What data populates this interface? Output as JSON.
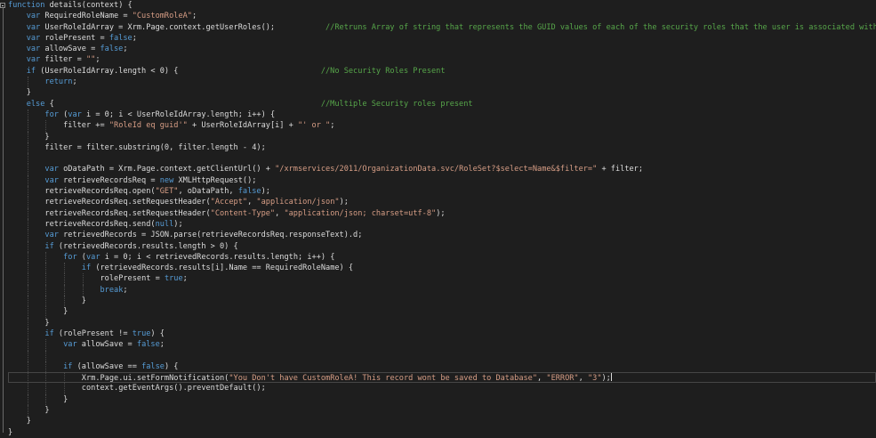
{
  "editor": {
    "background": "#1e1e1e",
    "colors": {
      "keyword": "#569cd6",
      "string": "#d69d85",
      "comment": "#57a64a",
      "text": "#dcdcdc"
    },
    "current_line": 34,
    "lines": [
      {
        "indent": 0,
        "tokens": [
          {
            "t": "kw",
            "v": "function"
          },
          {
            "t": "txt",
            "v": " details(context) {"
          }
        ]
      },
      {
        "indent": 1,
        "tokens": [
          {
            "t": "kw",
            "v": "var"
          },
          {
            "t": "txt",
            "v": " RequiredRoleName = "
          },
          {
            "t": "str",
            "v": "\"CustomRoleA\""
          },
          {
            "t": "txt",
            "v": ";"
          }
        ]
      },
      {
        "indent": 1,
        "tokens": [
          {
            "t": "kw",
            "v": "var"
          },
          {
            "t": "txt",
            "v": " UserRoleIdArray = Xrm.Page.context.getUserRoles();           "
          },
          {
            "t": "com",
            "v": "//Retruns Array of string that represents the GUID values of each of the security roles that the user is associated with"
          }
        ]
      },
      {
        "indent": 1,
        "tokens": [
          {
            "t": "kw",
            "v": "var"
          },
          {
            "t": "txt",
            "v": " rolePresent = "
          },
          {
            "t": "kw",
            "v": "false"
          },
          {
            "t": "txt",
            "v": ";"
          }
        ]
      },
      {
        "indent": 1,
        "tokens": [
          {
            "t": "kw",
            "v": "var"
          },
          {
            "t": "txt",
            "v": " allowSave = "
          },
          {
            "t": "kw",
            "v": "false"
          },
          {
            "t": "txt",
            "v": ";"
          }
        ]
      },
      {
        "indent": 1,
        "tokens": [
          {
            "t": "kw",
            "v": "var"
          },
          {
            "t": "txt",
            "v": " filter = "
          },
          {
            "t": "str",
            "v": "\"\""
          },
          {
            "t": "txt",
            "v": ";"
          }
        ]
      },
      {
        "indent": 1,
        "tokens": [
          {
            "t": "kw",
            "v": "if"
          },
          {
            "t": "txt",
            "v": " (UserRoleIdArray.length < 0) {                               "
          },
          {
            "t": "com",
            "v": "//No Security Roles Present"
          }
        ]
      },
      {
        "indent": 2,
        "tokens": [
          {
            "t": "kw",
            "v": "return"
          },
          {
            "t": "txt",
            "v": ";"
          }
        ]
      },
      {
        "indent": 1,
        "tokens": [
          {
            "t": "txt",
            "v": "}"
          }
        ]
      },
      {
        "indent": 1,
        "tokens": [
          {
            "t": "kw",
            "v": "else"
          },
          {
            "t": "txt",
            "v": " {                                                          "
          },
          {
            "t": "com",
            "v": "//Multiple Security roles present"
          }
        ]
      },
      {
        "indent": 2,
        "tokens": [
          {
            "t": "kw",
            "v": "for"
          },
          {
            "t": "txt",
            "v": " ("
          },
          {
            "t": "kw",
            "v": "var"
          },
          {
            "t": "txt",
            "v": " i = 0; i < UserRoleIdArray.length; i++) {"
          }
        ]
      },
      {
        "indent": 3,
        "tokens": [
          {
            "t": "txt",
            "v": "filter += "
          },
          {
            "t": "str",
            "v": "\"RoleId eq guid'\""
          },
          {
            "t": "txt",
            "v": " + UserRoleIdArray[i] + "
          },
          {
            "t": "str",
            "v": "\"' or \""
          },
          {
            "t": "txt",
            "v": ";"
          }
        ]
      },
      {
        "indent": 2,
        "tokens": [
          {
            "t": "txt",
            "v": "}"
          }
        ]
      },
      {
        "indent": 2,
        "tokens": [
          {
            "t": "txt",
            "v": "filter = filter.substring(0, filter.length - 4);"
          }
        ]
      },
      {
        "indent": 2,
        "tokens": []
      },
      {
        "indent": 2,
        "tokens": [
          {
            "t": "kw",
            "v": "var"
          },
          {
            "t": "txt",
            "v": " oDataPath = Xrm.Page.context.getClientUrl() + "
          },
          {
            "t": "str",
            "v": "\"/xrmservices/2011/OrganizationData.svc/RoleSet?$select=Name&$filter=\""
          },
          {
            "t": "txt",
            "v": " + filter;"
          }
        ]
      },
      {
        "indent": 2,
        "tokens": [
          {
            "t": "kw",
            "v": "var"
          },
          {
            "t": "txt",
            "v": " retrieveRecordsReq = "
          },
          {
            "t": "kw",
            "v": "new"
          },
          {
            "t": "txt",
            "v": " XMLHttpRequest();"
          }
        ]
      },
      {
        "indent": 2,
        "tokens": [
          {
            "t": "txt",
            "v": "retrieveRecordsReq.open("
          },
          {
            "t": "str",
            "v": "\"GET\""
          },
          {
            "t": "txt",
            "v": ", oDataPath, "
          },
          {
            "t": "kw",
            "v": "false"
          },
          {
            "t": "txt",
            "v": ");"
          }
        ]
      },
      {
        "indent": 2,
        "tokens": [
          {
            "t": "txt",
            "v": "retrieveRecordsReq.setRequestHeader("
          },
          {
            "t": "str",
            "v": "\"Accept\""
          },
          {
            "t": "txt",
            "v": ", "
          },
          {
            "t": "str",
            "v": "\"application/json\""
          },
          {
            "t": "txt",
            "v": ");"
          }
        ]
      },
      {
        "indent": 2,
        "tokens": [
          {
            "t": "txt",
            "v": "retrieveRecordsReq.setRequestHeader("
          },
          {
            "t": "str",
            "v": "\"Content-Type\""
          },
          {
            "t": "txt",
            "v": ", "
          },
          {
            "t": "str",
            "v": "\"application/json; charset=utf-8\""
          },
          {
            "t": "txt",
            "v": ");"
          }
        ]
      },
      {
        "indent": 2,
        "tokens": [
          {
            "t": "txt",
            "v": "retrieveRecordsReq.send("
          },
          {
            "t": "kw",
            "v": "null"
          },
          {
            "t": "txt",
            "v": ");"
          }
        ]
      },
      {
        "indent": 2,
        "tokens": [
          {
            "t": "kw",
            "v": "var"
          },
          {
            "t": "txt",
            "v": " retrievedRecords = JSON.parse(retrieveRecordsReq.responseText).d;"
          }
        ]
      },
      {
        "indent": 2,
        "tokens": [
          {
            "t": "kw",
            "v": "if"
          },
          {
            "t": "txt",
            "v": " (retrievedRecords.results.length > 0) {"
          }
        ]
      },
      {
        "indent": 3,
        "tokens": [
          {
            "t": "kw",
            "v": "for"
          },
          {
            "t": "txt",
            "v": " ("
          },
          {
            "t": "kw",
            "v": "var"
          },
          {
            "t": "txt",
            "v": " i = 0; i < retrievedRecords.results.length; i++) {"
          }
        ]
      },
      {
        "indent": 4,
        "tokens": [
          {
            "t": "kw",
            "v": "if"
          },
          {
            "t": "txt",
            "v": " (retrievedRecords.results[i].Name == RequiredRoleName) {"
          }
        ]
      },
      {
        "indent": 5,
        "tokens": [
          {
            "t": "txt",
            "v": "rolePresent = "
          },
          {
            "t": "kw",
            "v": "true"
          },
          {
            "t": "txt",
            "v": ";"
          }
        ]
      },
      {
        "indent": 5,
        "tokens": [
          {
            "t": "kw",
            "v": "break"
          },
          {
            "t": "txt",
            "v": ";"
          }
        ]
      },
      {
        "indent": 4,
        "tokens": [
          {
            "t": "txt",
            "v": "}"
          }
        ]
      },
      {
        "indent": 3,
        "tokens": [
          {
            "t": "txt",
            "v": "}"
          }
        ]
      },
      {
        "indent": 2,
        "tokens": [
          {
            "t": "txt",
            "v": "}"
          }
        ]
      },
      {
        "indent": 2,
        "tokens": [
          {
            "t": "kw",
            "v": "if"
          },
          {
            "t": "txt",
            "v": " (rolePresent != "
          },
          {
            "t": "kw",
            "v": "true"
          },
          {
            "t": "txt",
            "v": ") {"
          }
        ]
      },
      {
        "indent": 3,
        "tokens": [
          {
            "t": "kw",
            "v": "var"
          },
          {
            "t": "txt",
            "v": " allowSave = "
          },
          {
            "t": "kw",
            "v": "false"
          },
          {
            "t": "txt",
            "v": ";"
          }
        ]
      },
      {
        "indent": 3,
        "tokens": []
      },
      {
        "indent": 3,
        "tokens": [
          {
            "t": "kw",
            "v": "if"
          },
          {
            "t": "txt",
            "v": " (allowSave == "
          },
          {
            "t": "kw",
            "v": "false"
          },
          {
            "t": "txt",
            "v": ") {"
          }
        ]
      },
      {
        "indent": 4,
        "tokens": [
          {
            "t": "txt",
            "v": "Xrm.Page.ui.setFormNotification("
          },
          {
            "t": "str",
            "v": "\"You Don't have CustomRoleA! This record wont be saved to Database\""
          },
          {
            "t": "txt",
            "v": ", "
          },
          {
            "t": "str",
            "v": "\"ERROR\""
          },
          {
            "t": "txt",
            "v": ", "
          },
          {
            "t": "str",
            "v": "\"3\""
          },
          {
            "t": "txt",
            "v": ");"
          }
        ]
      },
      {
        "indent": 4,
        "tokens": [
          {
            "t": "txt",
            "v": "context.getEventArgs().preventDefault();"
          }
        ]
      },
      {
        "indent": 3,
        "tokens": [
          {
            "t": "txt",
            "v": "}"
          }
        ]
      },
      {
        "indent": 2,
        "tokens": [
          {
            "t": "txt",
            "v": "}"
          }
        ]
      },
      {
        "indent": 1,
        "tokens": [
          {
            "t": "txt",
            "v": "}"
          }
        ]
      },
      {
        "indent": 0,
        "tokens": [
          {
            "t": "txt",
            "v": "}"
          }
        ]
      }
    ]
  }
}
